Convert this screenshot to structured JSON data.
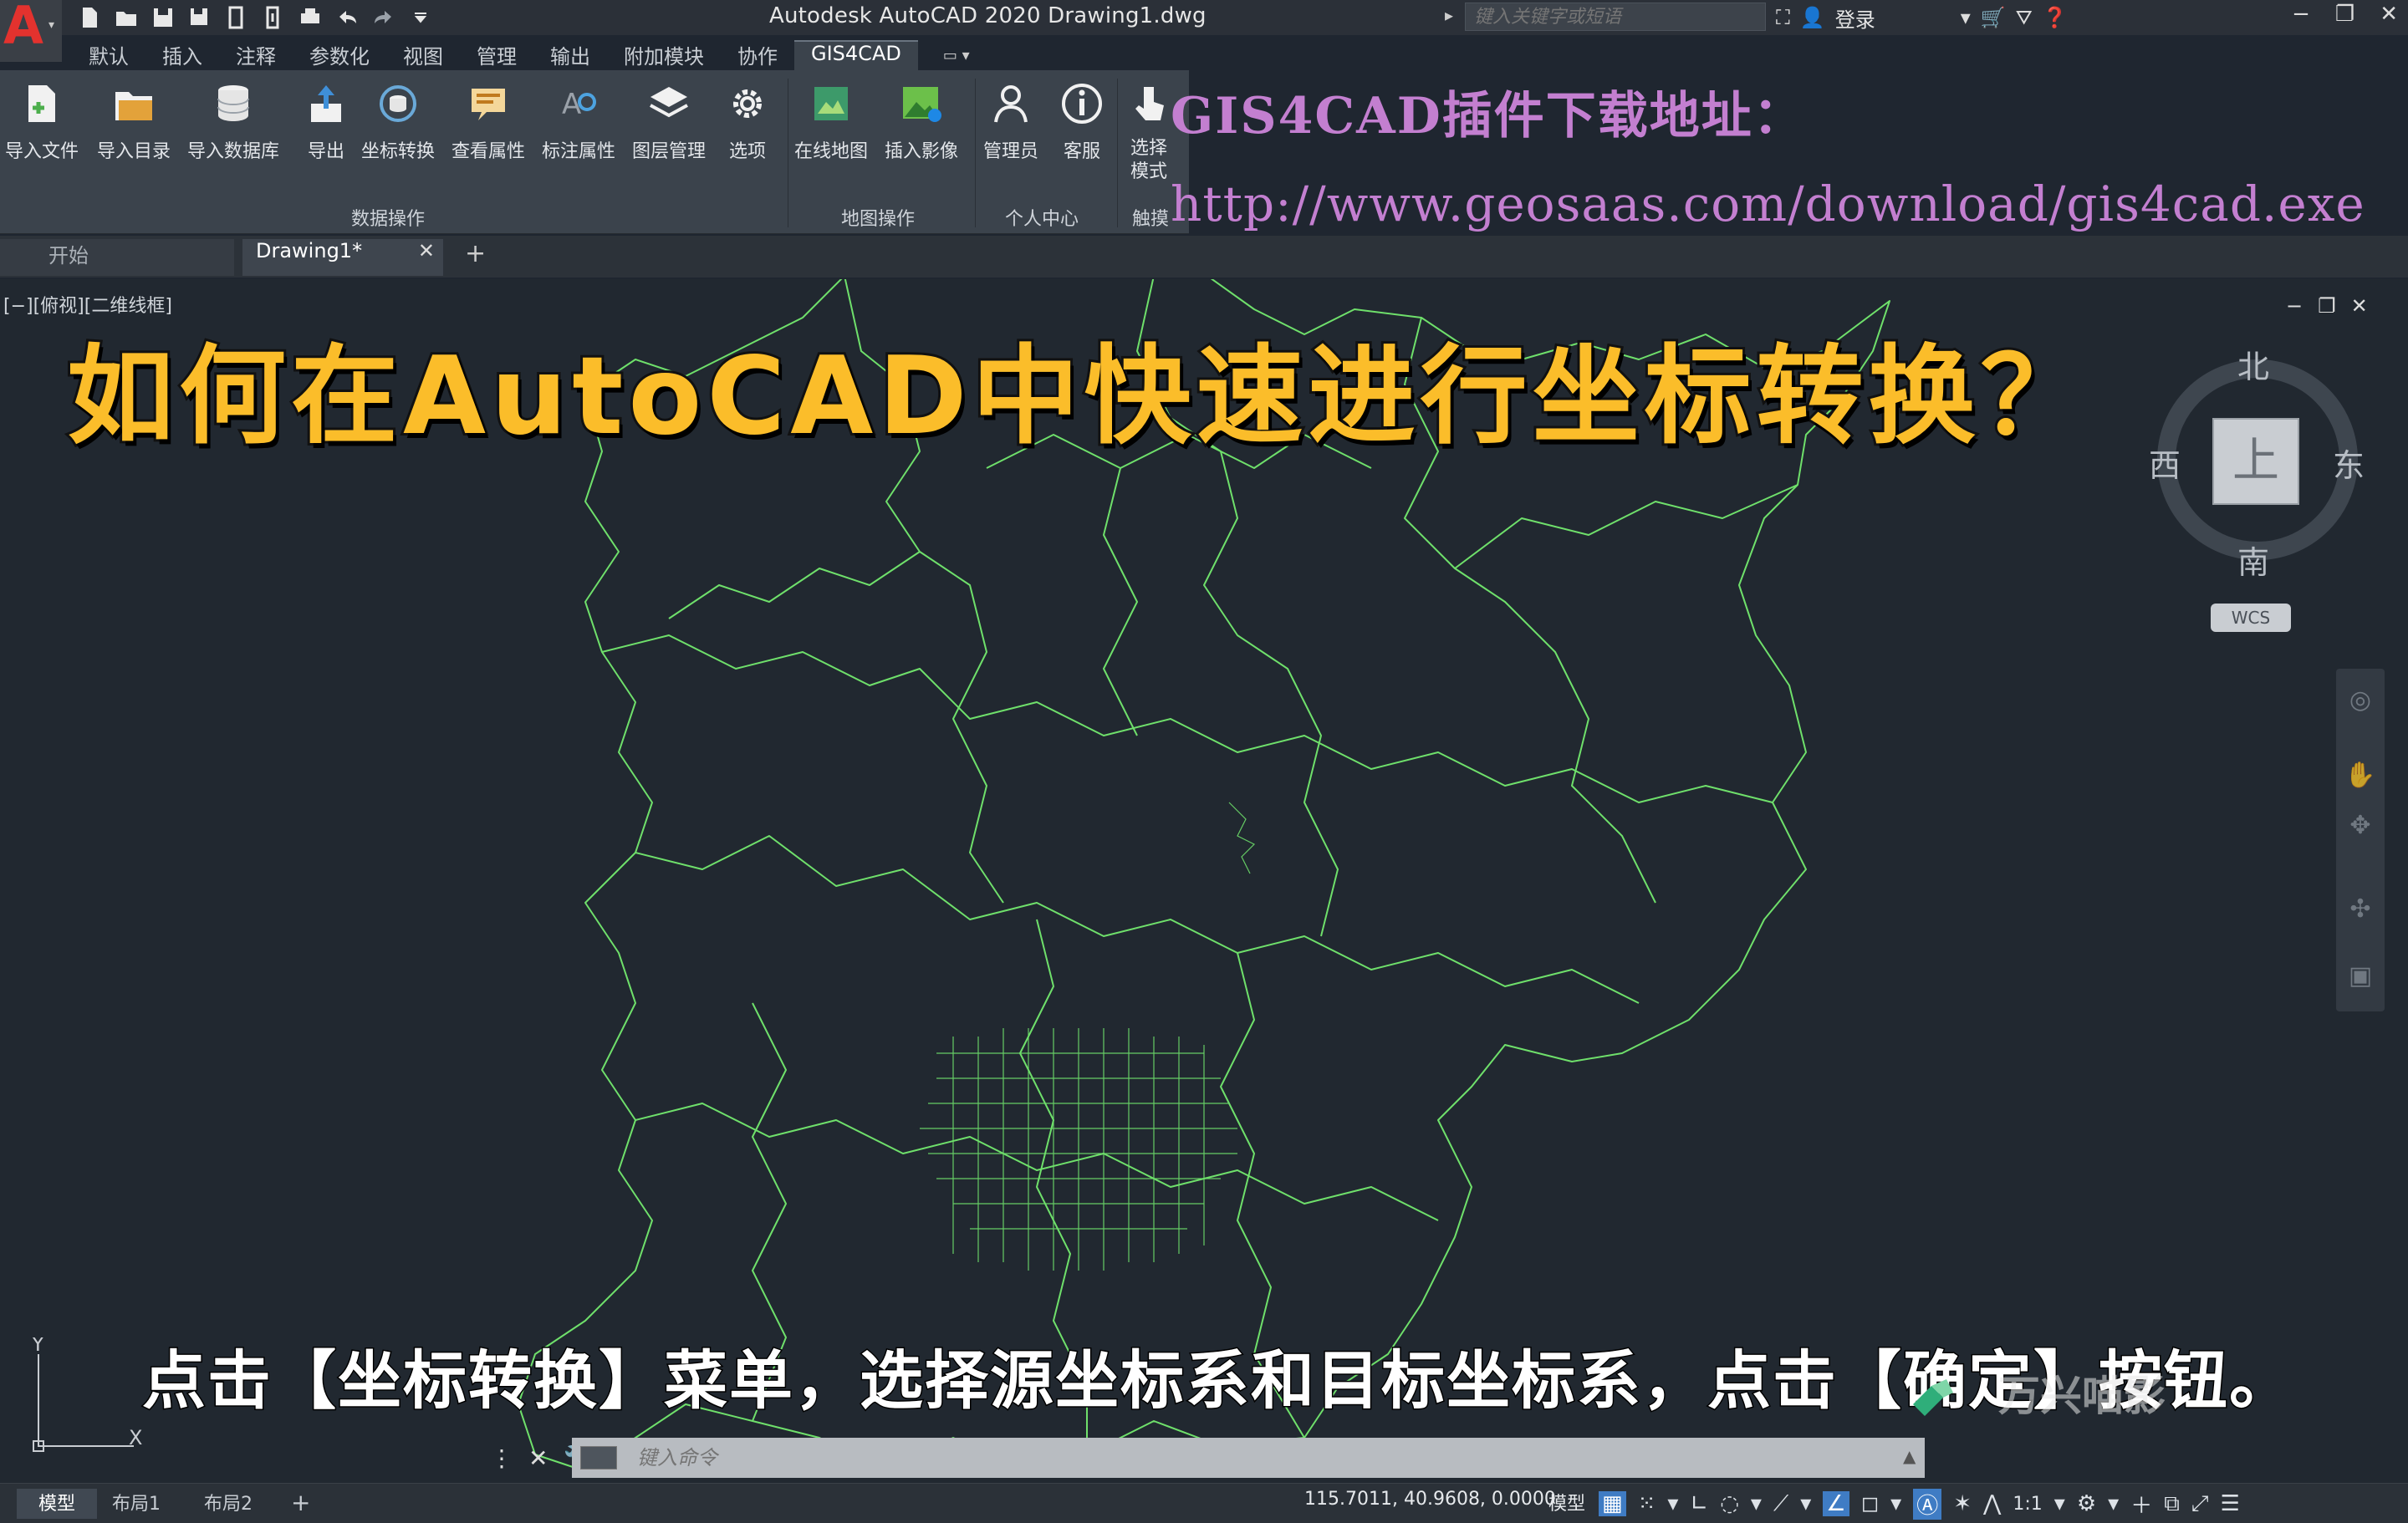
{
  "window": {
    "title": "Autodesk AutoCAD 2020    Drawing1.dwg",
    "app_logo": "A",
    "search_placeholder": "键入关键字或短语",
    "login_label": "登录"
  },
  "ribbon": {
    "tabs": [
      "默认",
      "插入",
      "注释",
      "参数化",
      "视图",
      "管理",
      "输出",
      "附加模块",
      "协作",
      "GIS4CAD"
    ],
    "active_tab": "GIS4CAD",
    "buttons": [
      {
        "label": "导入文件",
        "icon": "import-file-icon"
      },
      {
        "label": "导入目录",
        "icon": "import-folder-icon"
      },
      {
        "label": "导入数据库",
        "icon": "import-database-icon"
      },
      {
        "label": "导出",
        "icon": "export-icon"
      },
      {
        "label": "坐标转换",
        "icon": "coordinate-transform-icon"
      },
      {
        "label": "查看属性",
        "icon": "view-attributes-icon"
      },
      {
        "label": "标注属性",
        "icon": "annotate-attributes-icon"
      },
      {
        "label": "图层管理",
        "icon": "layer-manager-icon"
      },
      {
        "label": "选项",
        "icon": "gear-icon"
      },
      {
        "label": "在线地图",
        "icon": "online-map-icon"
      },
      {
        "label": "插入影像",
        "icon": "insert-image-icon"
      },
      {
        "label": "管理员",
        "icon": "user-icon"
      },
      {
        "label": "客服",
        "icon": "info-icon"
      },
      {
        "label": "选择\n模式",
        "icon": "cursor-icon"
      }
    ],
    "groups": [
      "数据操作",
      "地图操作",
      "个人中心",
      "触摸"
    ]
  },
  "overlay": {
    "plugin_line1": "GIS4CAD插件下载地址：",
    "plugin_line2": "http://www.geosaas.com/download/gis4cad.exe",
    "main_title": "如何在AutoCAD中快速进行坐标转换？",
    "subtitle": "点击【坐标转换】菜单，选择源坐标系和目标坐标系，点击【确定】按钮。",
    "watermark": "万兴喵影"
  },
  "doc_tabs": {
    "start": "开始",
    "drawing": "Drawing1*",
    "close": "✕",
    "add": "+"
  },
  "viewport": {
    "label": "[−][俯视][二维线框]",
    "viewcube": {
      "north": "北",
      "south": "南",
      "east": "东",
      "west": "西",
      "top": "上",
      "wcs": "WCS"
    }
  },
  "command_line": {
    "placeholder": "键入命令"
  },
  "status": {
    "layouts": [
      "模型",
      "布局1",
      "布局2"
    ],
    "add": "+",
    "coordinates": "115.7011, 40.9608, 0.0000",
    "model_label": "模型",
    "scale": "1:1"
  },
  "colors": {
    "map_lines": "#6fe06b",
    "title_fill": "#fbbd2a",
    "plugin_text": "#c37fd0",
    "canvas_bg": "#212830"
  }
}
